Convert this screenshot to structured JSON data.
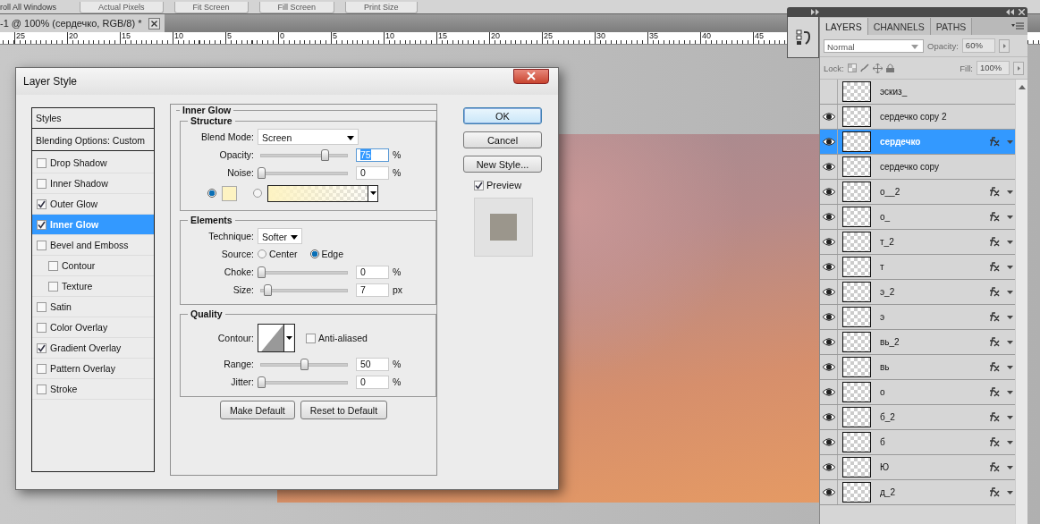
{
  "toolbar": {
    "buttons": [
      "roll All Windows",
      "Actual Pixels",
      "Fit Screen",
      "Fill Screen",
      "Print Size"
    ]
  },
  "document_tab": {
    "title": "-1 @ 100% (сердечко, RGB/8) *"
  },
  "ruler": {
    "labels": [
      "25",
      "20",
      "15",
      "10",
      "5",
      "0",
      "5",
      "10",
      "15",
      "20",
      "25",
      "30",
      "35",
      "40",
      "45"
    ]
  },
  "dialog": {
    "title": "Layer Style",
    "styles_header": "Styles",
    "blending_options": "Blending Options: Custom",
    "effects": [
      {
        "label": "Drop Shadow",
        "checked": false,
        "selected": false
      },
      {
        "label": "Inner Shadow",
        "checked": false,
        "selected": false
      },
      {
        "label": "Outer Glow",
        "checked": true,
        "selected": false
      },
      {
        "label": "Inner Glow",
        "checked": true,
        "selected": true
      },
      {
        "label": "Bevel and Emboss",
        "checked": false,
        "selected": false,
        "children": [
          {
            "label": "Contour",
            "checked": false,
            "selected": false
          },
          {
            "label": "Texture",
            "checked": false,
            "selected": false
          }
        ]
      },
      {
        "label": "Satin",
        "checked": false,
        "selected": false
      },
      {
        "label": "Color Overlay",
        "checked": false,
        "selected": false
      },
      {
        "label": "Gradient Overlay",
        "checked": true,
        "selected": false
      },
      {
        "label": "Pattern Overlay",
        "checked": false,
        "selected": false
      },
      {
        "label": "Stroke",
        "checked": false,
        "selected": false
      }
    ],
    "panel_title": "Inner Glow",
    "structure": {
      "title": "Structure",
      "blend_mode": {
        "label": "Blend Mode:",
        "value": "Screen"
      },
      "sliders": [
        {
          "label": "Opacity:",
          "level": 0.75,
          "value": "75",
          "unit": "%",
          "focused": true
        },
        {
          "label": "Noise:",
          "level": 0,
          "value": "0",
          "unit": "%",
          "focused": false
        }
      ],
      "fill": [
        {
          "kind": "color",
          "selected": true,
          "color": "#fdf3c2"
        },
        {
          "kind": "gradient",
          "selected": false,
          "color": "#fdf3c2"
        }
      ]
    },
    "elements": {
      "title": "Elements",
      "technique": {
        "label": "Technique:",
        "value": "Softer"
      },
      "source": {
        "label": "Source:",
        "options": [
          {
            "label": "Center",
            "selected": false
          },
          {
            "label": "Edge",
            "selected": true
          }
        ]
      },
      "sliders": [
        {
          "label": "Choke:",
          "level": 0,
          "value": "0",
          "unit": "%",
          "focused": false
        },
        {
          "label": "Size:",
          "level": 0.07,
          "value": "7",
          "unit": "px",
          "focused": false
        }
      ]
    },
    "quality": {
      "title": "Quality",
      "contour_label": "Contour:",
      "anti_aliased": {
        "label": "Anti-aliased",
        "checked": false
      },
      "sliders": [
        {
          "label": "Range:",
          "level": 0.5,
          "value": "50",
          "unit": "%",
          "focused": false
        },
        {
          "label": "Jitter:",
          "level": 0,
          "value": "0",
          "unit": "%",
          "focused": false
        }
      ]
    },
    "buttons": [
      "Make Default",
      "Reset to Default"
    ],
    "side_buttons": [
      {
        "label": "OK",
        "default": true
      },
      {
        "label": "Cancel",
        "default": false
      },
      {
        "label": "New Style...",
        "default": false
      }
    ],
    "preview": {
      "label": "Preview",
      "checked": true
    }
  },
  "layers_panel": {
    "tabs": [
      {
        "label": "LAYERS",
        "selected": true
      },
      {
        "label": "CHANNELS",
        "selected": false
      },
      {
        "label": "PATHS",
        "selected": false
      }
    ],
    "blend_mode": "Normal",
    "opacity_label": "Opacity:",
    "opacity": "60%",
    "lock_label": "Lock:",
    "fill_label": "Fill:",
    "fill": "100%",
    "layers": [
      {
        "name": "эскиз_",
        "visible": false,
        "effects": false,
        "selected": false
      },
      {
        "name": "сердечко copy 2",
        "visible": true,
        "effects": false,
        "selected": false
      },
      {
        "name": "сердечко",
        "visible": true,
        "effects": true,
        "selected": true
      },
      {
        "name": "сердечко copy",
        "visible": true,
        "effects": false,
        "selected": false
      },
      {
        "name": "о__2",
        "visible": true,
        "effects": true,
        "selected": false
      },
      {
        "name": "о_",
        "visible": true,
        "effects": true,
        "selected": false
      },
      {
        "name": "т_2",
        "visible": true,
        "effects": true,
        "selected": false
      },
      {
        "name": "т",
        "visible": true,
        "effects": true,
        "selected": false
      },
      {
        "name": "э_2",
        "visible": true,
        "effects": true,
        "selected": false
      },
      {
        "name": "э",
        "visible": true,
        "effects": true,
        "selected": false
      },
      {
        "name": "вь_2",
        "visible": true,
        "effects": true,
        "selected": false
      },
      {
        "name": "вь",
        "visible": true,
        "effects": true,
        "selected": false
      },
      {
        "name": "о",
        "visible": true,
        "effects": true,
        "selected": false
      },
      {
        "name": "б_2",
        "visible": true,
        "effects": true,
        "selected": false
      },
      {
        "name": "б",
        "visible": true,
        "effects": true,
        "selected": false
      },
      {
        "name": "Ю",
        "visible": true,
        "effects": true,
        "selected": false
      },
      {
        "name": "д_2",
        "visible": true,
        "effects": true,
        "selected": false
      }
    ]
  }
}
